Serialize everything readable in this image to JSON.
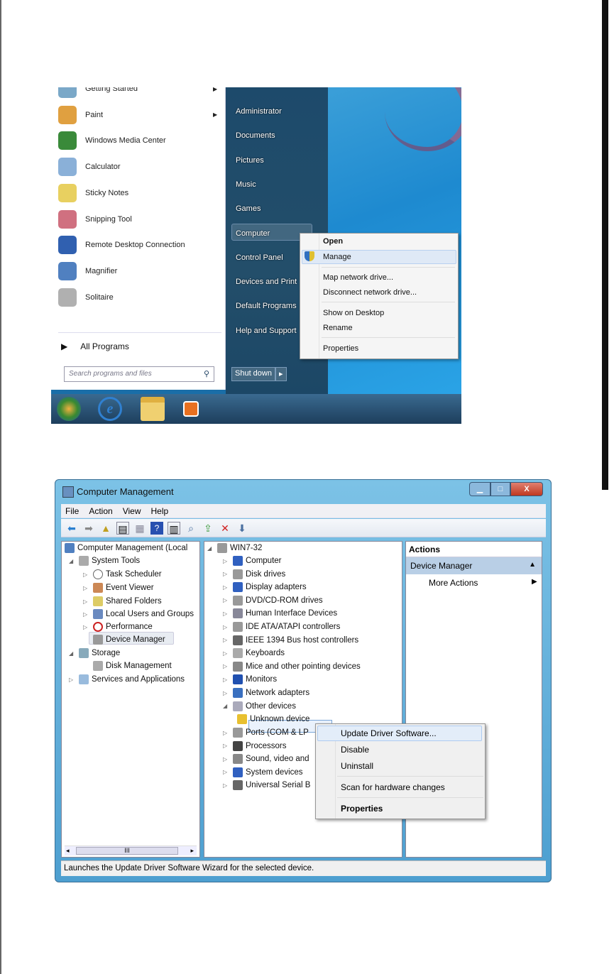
{
  "start_menu": {
    "programs": [
      {
        "label": "Getting Started",
        "submenu": true,
        "color": "#7aa8c8"
      },
      {
        "label": "Paint",
        "submenu": true,
        "color": "#e0a040"
      },
      {
        "label": "Windows Media Center",
        "submenu": false,
        "color": "#3a8a3a"
      },
      {
        "label": "Calculator",
        "submenu": false,
        "color": "#8ab0d8"
      },
      {
        "label": "Sticky Notes",
        "submenu": false,
        "color": "#e8d060"
      },
      {
        "label": "Snipping Tool",
        "submenu": false,
        "color": "#d07080"
      },
      {
        "label": "Remote Desktop Connection",
        "submenu": false,
        "color": "#3060b0"
      },
      {
        "label": "Magnifier",
        "submenu": false,
        "color": "#5080c0"
      },
      {
        "label": "Solitaire",
        "submenu": false,
        "color": "#b0b0b0"
      }
    ],
    "all_programs": "All Programs",
    "search_placeholder": "Search programs and files",
    "right_items": [
      "Administrator",
      "Documents",
      "Pictures",
      "Music",
      "Games",
      "Computer",
      "Control Panel",
      "Devices and Print",
      "Default Programs",
      "Help and Support"
    ],
    "shutdown": "Shut down",
    "context_menu": {
      "open": "Open",
      "manage": "Manage",
      "map": "Map network drive...",
      "disconnect": "Disconnect network drive...",
      "show": "Show on Desktop",
      "rename": "Rename",
      "properties": "Properties"
    }
  },
  "mmc": {
    "title": "Computer Management",
    "menu": [
      "File",
      "Action",
      "View",
      "Help"
    ],
    "tree": {
      "root": "Computer Management (Local",
      "system_tools": "System Tools",
      "task_scheduler": "Task Scheduler",
      "event_viewer": "Event Viewer",
      "shared_folders": "Shared Folders",
      "local_users": "Local Users and Groups",
      "performance": "Performance",
      "device_manager": "Device Manager",
      "storage": "Storage",
      "disk_management": "Disk Management",
      "services": "Services and Applications"
    },
    "devices": {
      "host": "WIN7-32",
      "items": [
        "Computer",
        "Disk drives",
        "Display adapters",
        "DVD/CD-ROM drives",
        "Human Interface Devices",
        "IDE ATA/ATAPI controllers",
        "IEEE 1394 Bus host controllers",
        "Keyboards",
        "Mice and other pointing devices",
        "Monitors",
        "Network adapters",
        "Other devices"
      ],
      "unknown": "Unknown device",
      "items_after": [
        "Ports (COM & LPT)",
        "Processors",
        "Sound, video and game controllers",
        "System devices",
        "Universal Serial Bus controllers"
      ],
      "items_after_visible": [
        "Ports (COM & LP",
        "Processors",
        "Sound, video and",
        "System devices",
        "Universal Serial B"
      ]
    },
    "actions": {
      "header": "Actions",
      "section": "Device Manager",
      "more": "More Actions"
    },
    "context_menu": {
      "update": "Update Driver Software...",
      "disable": "Disable",
      "uninstall": "Uninstall",
      "scan": "Scan for hardware changes",
      "properties": "Properties"
    },
    "status": "Launches the Update Driver Software Wizard for the selected device.",
    "scroll_thumb": "III"
  }
}
